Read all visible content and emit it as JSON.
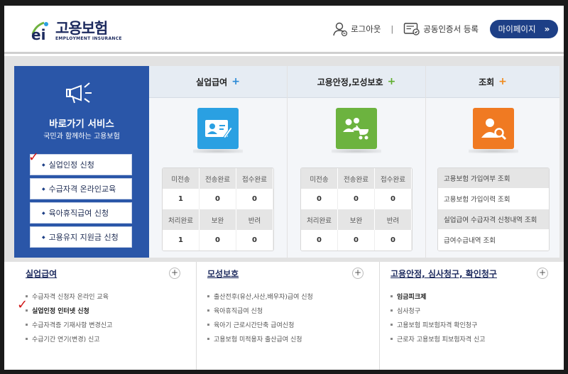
{
  "header": {
    "logo_title": "고용보험",
    "logo_sub": "EMPLOYMENT INSURANCE",
    "logout": "로그아웃",
    "separator": "|",
    "cert_register": "공동인증서 등록",
    "mypage": "마이페이지",
    "mypage_arrow": "»"
  },
  "quick": {
    "title": "바로가기 서비스",
    "subtitle": "국민과 함께하는 고용보험",
    "buttons": [
      "실업인정 신청",
      "수급자격 온라인교육",
      "육아휴직급여 신청",
      "고용유지 지원금 신청"
    ]
  },
  "columns": [
    {
      "title": "실업급여",
      "plus": "+",
      "plus_color": "#2b8ad6",
      "icon": "id-card-icon",
      "icon_color": "#2aa0e2",
      "headers1": [
        "미전송",
        "전송완료",
        "접수완료"
      ],
      "values1": [
        "1",
        "0",
        "0"
      ],
      "headers2": [
        "처리완료",
        "보완",
        "반려"
      ],
      "values2": [
        "1",
        "0",
        "0"
      ]
    },
    {
      "title": "고용안정,모성보호",
      "plus": "+",
      "plus_color": "#5fae2e",
      "icon": "family-stroller-icon",
      "icon_color": "#6cb33f",
      "headers1": [
        "미전송",
        "전송완료",
        "접수완료"
      ],
      "values1": [
        "0",
        "0",
        "0"
      ],
      "headers2": [
        "처리완료",
        "보완",
        "반려"
      ],
      "values2": [
        "0",
        "0",
        "0"
      ]
    },
    {
      "title": "조회",
      "plus": "+",
      "plus_color": "#f08a1c",
      "icon": "user-search-icon",
      "icon_color": "#f07a22",
      "items": [
        "고용보험 가입여부 조회",
        "고용보험 가입이력 조회",
        "실업급여 수급자격 신청내역 조회",
        "급여수급내역 조회"
      ]
    }
  ],
  "bottom": [
    {
      "title": "실업급여",
      "plus": "+",
      "items": [
        "수급자격 신청자 온라인 교육",
        "실업인정 인터넷 신청",
        "수급자격증 기재사항 변경신고",
        "수급기간 연기(변경) 신고"
      ],
      "bold_index": 1
    },
    {
      "title": "모성보호",
      "plus": "+",
      "items": [
        "출산전후(유산,사산,배우자)급여 신청",
        "육아휴직급여 신청",
        "육아기 근로시간단축 급여신청",
        "고용보험 미적용자 출산급여 신청"
      ],
      "bold_index": -1
    },
    {
      "title": "고용안정, 심사청구, 확인청구",
      "plus": "+",
      "items": [
        "임금피크제",
        "심사청구",
        "고용보험 피보험자격 확인청구",
        "근로자 고용보험 피보험자격 신고"
      ],
      "bold_index": 0
    }
  ],
  "annotation_check": "✓"
}
